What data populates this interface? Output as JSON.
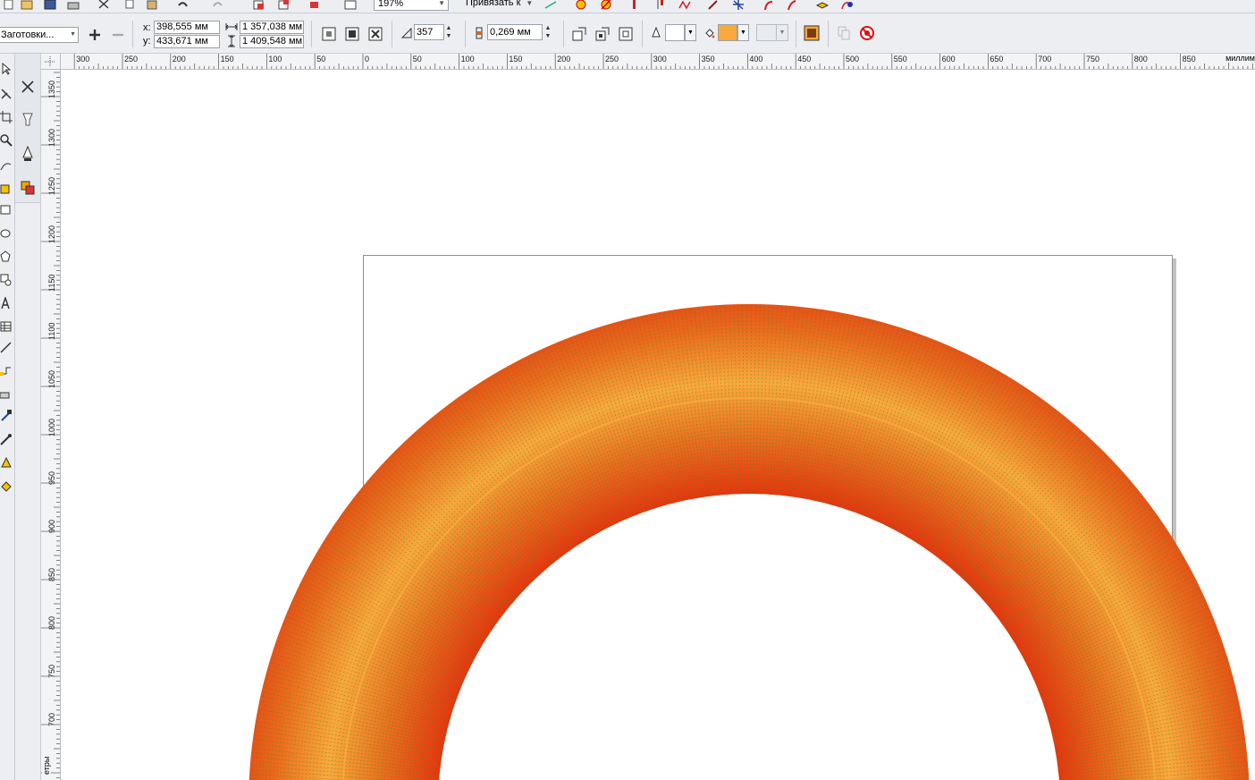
{
  "toolbar": {
    "zoom_value": "197%",
    "snap_label": "Привязать к"
  },
  "property_bar": {
    "presets_label": "Заготовки...",
    "x_label": "x:",
    "x_value": "398,555 мм",
    "y_label": "y:",
    "y_value": "433,671 мм",
    "width_value": "1 357,038 мм",
    "height_value": "1 409,548 мм",
    "steps_value": "357",
    "offset_value": "0,269 мм",
    "outline_color": "#ffffff",
    "fill_color": "#f9a93c"
  },
  "rulers": {
    "horizontal_ticks": [
      "300",
      "250",
      "200",
      "150",
      "100",
      "50",
      "0",
      "50",
      "100",
      "150",
      "200",
      "250",
      "300",
      "350",
      "400",
      "450",
      "500",
      "550",
      "600",
      "650",
      "700",
      "750",
      "800",
      "850"
    ],
    "vertical_ticks": [
      "1350",
      "1300",
      "1250",
      "1200",
      "1150",
      "1100",
      "1050",
      "1000",
      "950",
      "900",
      "850",
      "800",
      "750",
      "700"
    ],
    "unit_h": "миллим",
    "unit_v": "етры"
  },
  "artwork": {
    "gradient_colors": [
      "#e8350f",
      "#e86d1e",
      "#f9a93c",
      "#e86d1e",
      "#e8350f"
    ],
    "stroke_color": "#3c8a1a"
  }
}
